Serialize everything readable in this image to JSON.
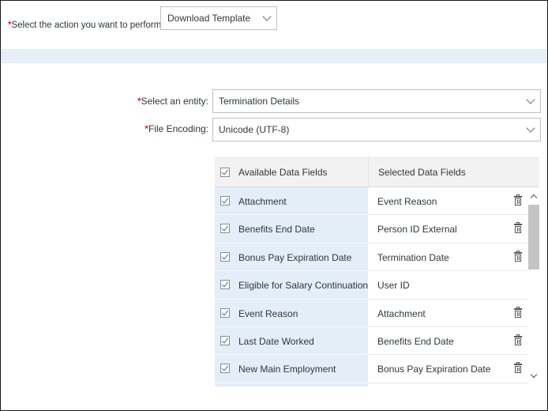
{
  "action": {
    "label": "Select the action you want to perform:",
    "required_mark": "*",
    "selected": "Download Template"
  },
  "form": {
    "entity": {
      "label": "Select an entity:",
      "required_mark": "*",
      "value": "Termination Details"
    },
    "encoding": {
      "label": "File Encoding:",
      "required_mark": "*",
      "value": "Unicode (UTF-8)"
    }
  },
  "table": {
    "available_header": "Available Data Fields",
    "selected_header": "Selected Data Fields",
    "available": [
      "Attachment",
      "Benefits End Date",
      "Bonus Pay Expiration Date",
      "Eligible for Salary Continuation",
      "Event Reason",
      "Last Date Worked",
      "New Main Employment"
    ],
    "selected": [
      {
        "label": "Event Reason",
        "deletable": true
      },
      {
        "label": "Person ID External",
        "deletable": true
      },
      {
        "label": "Termination Date",
        "deletable": true
      },
      {
        "label": "User ID",
        "deletable": false
      },
      {
        "label": "Attachment",
        "deletable": true
      },
      {
        "label": "Benefits End Date",
        "deletable": true
      },
      {
        "label": "Bonus Pay Expiration Date",
        "deletable": true
      }
    ]
  },
  "icons": {
    "checkbox": "checkbox-checked-icon",
    "delete": "trash-icon",
    "dropdown": "chevron-down-icon"
  },
  "colors": {
    "required": "#e0301e",
    "available_bg": "#e3eef8",
    "band": "#e6eef7"
  }
}
